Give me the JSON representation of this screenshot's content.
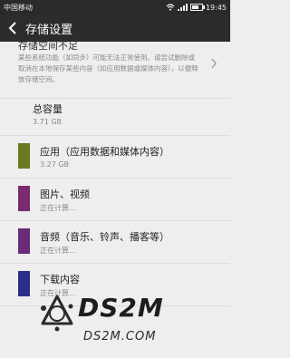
{
  "status": {
    "carrier": "中国移动",
    "time": "19:45"
  },
  "header": {
    "title": "存储设置"
  },
  "warning": {
    "title": "存储空间不足",
    "description": "某些系统功能（如同步）可能无法正常使用。请尝试删除或取消在本地保存某些内容（如应用数据或媒体内容），以便释放存储空间。"
  },
  "total": {
    "label": "总容量",
    "value": "3.71 GB"
  },
  "categories": [
    {
      "label": "应用（应用数据和媒体内容）",
      "value": "3.27 GB",
      "color": "#6b7a1f"
    },
    {
      "label": "图片、视频",
      "value": "正在计算...",
      "color": "#7a2a6e"
    },
    {
      "label": "音频（音乐、铃声、播客等）",
      "value": "正在计算...",
      "color": "#6a2a7a"
    },
    {
      "label": "下载内容",
      "value": "正在计算...",
      "color": "#2a2f8a"
    }
  ],
  "watermark": {
    "title": "DS2M",
    "url": "DS2M.COM"
  }
}
